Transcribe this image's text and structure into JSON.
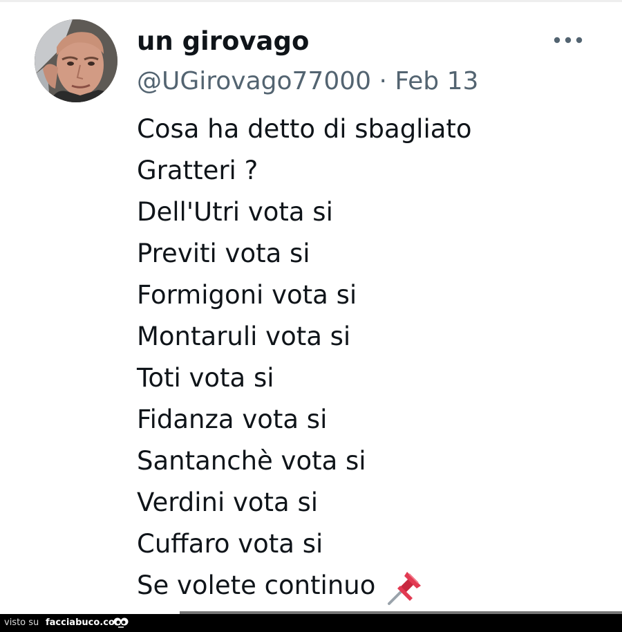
{
  "tweet": {
    "author": {
      "display_name": "un girovago",
      "handle": "@UGirovago77000",
      "separator": "·",
      "date": "Feb 13",
      "avatar_icon": "profile-photo"
    },
    "more_icon": "ellipsis-icon",
    "lines": [
      "Cosa ha detto di sbagliato",
      "Gratteri ?",
      "Dell'Utri vota si",
      "Previti vota si",
      "Formigoni vota si",
      "Montaruli vota si",
      "Toti vota si",
      "Fidanza vota si",
      "Santanchè vota si",
      "Verdini vota si",
      "Cuffaro vota si",
      "Se volete continuo"
    ],
    "trailing_emoji": "pushpin-icon"
  },
  "footer": {
    "visto_su": "visto su",
    "brand": "facciabuco.com"
  },
  "colors": {
    "text": "#0f1419",
    "secondary": "#536471",
    "pin": "#d9304a",
    "footer_bg": "#000000"
  }
}
